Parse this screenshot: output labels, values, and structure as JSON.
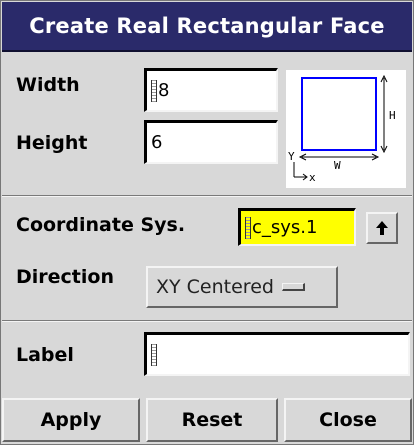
{
  "window": {
    "title": "Create Real Rectangular Face"
  },
  "size": {
    "width_label": "Width",
    "width_value": "8",
    "height_label": "Height",
    "height_value": "6"
  },
  "diagram": {
    "h_label": "H",
    "w_label": "W",
    "y_label": "Y",
    "x_label": "x",
    "rect_color": "#0000ff"
  },
  "coords": {
    "label": "Coordinate Sys.",
    "value": "c_sys.1",
    "field_color": "#ffff00",
    "pick_icon": "up-arrow-icon",
    "direction_label": "Direction",
    "direction_value": "XY Centered"
  },
  "label_section": {
    "label": "Label",
    "value": ""
  },
  "buttons": {
    "apply": "Apply",
    "reset": "Reset",
    "close": "Close"
  }
}
